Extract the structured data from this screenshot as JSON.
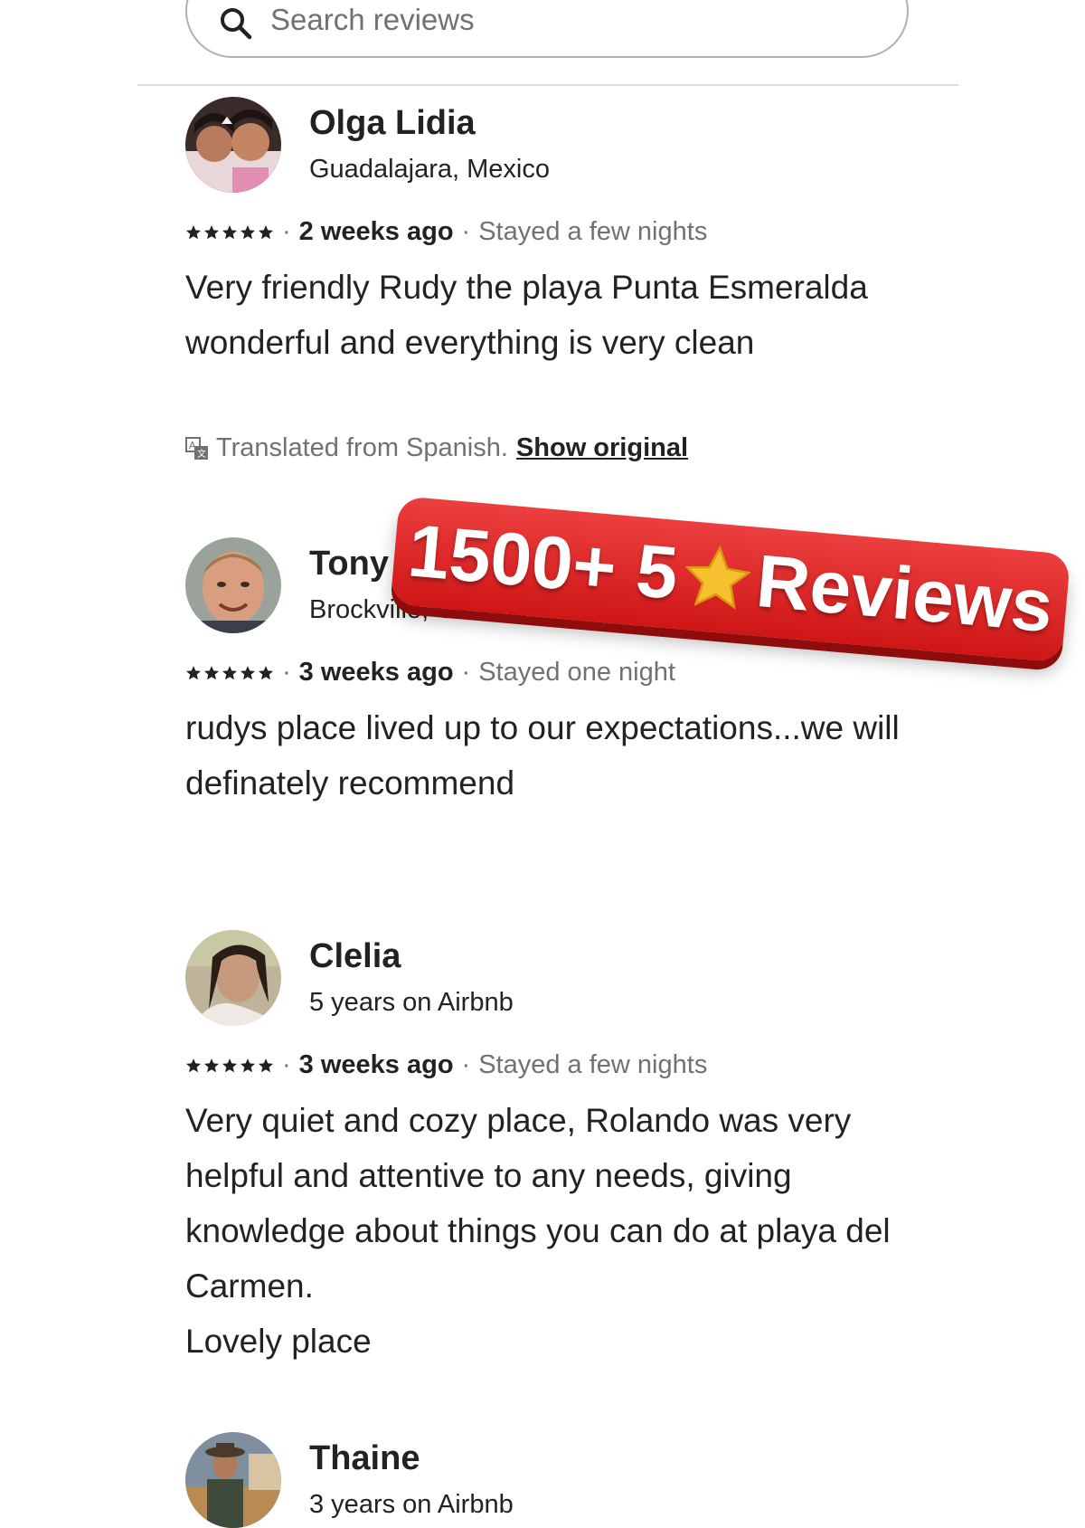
{
  "search": {
    "placeholder": "Search reviews"
  },
  "reviews": [
    {
      "name": "Olga Lidia",
      "subtitle": "Guadalajara, Mexico",
      "rating": 5,
      "when": "2 weeks ago",
      "stay": "Stayed a few nights",
      "text": [
        "Very friendly Rudy the playa Punta Esmeralda wonderful and everything is very clean"
      ],
      "translated": "Translated from Spanish.",
      "show_original": "Show original"
    },
    {
      "name": "Tony",
      "subtitle": "Brockville, Canada",
      "rating": 5,
      "when": "3 weeks ago",
      "stay": "Stayed one night",
      "text": [
        "rudys place lived up to our expectations...we will definately recommend"
      ]
    },
    {
      "name": "Clelia",
      "subtitle": "5 years on Airbnb",
      "rating": 5,
      "when": "3 weeks ago",
      "stay": "Stayed a few nights",
      "text": [
        "Very quiet and cozy place, Rolando was very helpful and attentive to any needs, giving knowledge about things you can do at playa del Carmen.",
        "Lovely place"
      ]
    },
    {
      "name": "Thaine",
      "subtitle": "3 years on Airbnb"
    }
  ],
  "banner": {
    "count": "1500+ 5",
    "word": "Reviews"
  },
  "colors": {
    "banner_red": "#d91f1f",
    "muted": "#717171",
    "text": "#222222",
    "divider": "#dddddd"
  },
  "icons": {
    "search": "magnifier-icon",
    "translate": "translate-icon",
    "rating": "star-icon"
  }
}
